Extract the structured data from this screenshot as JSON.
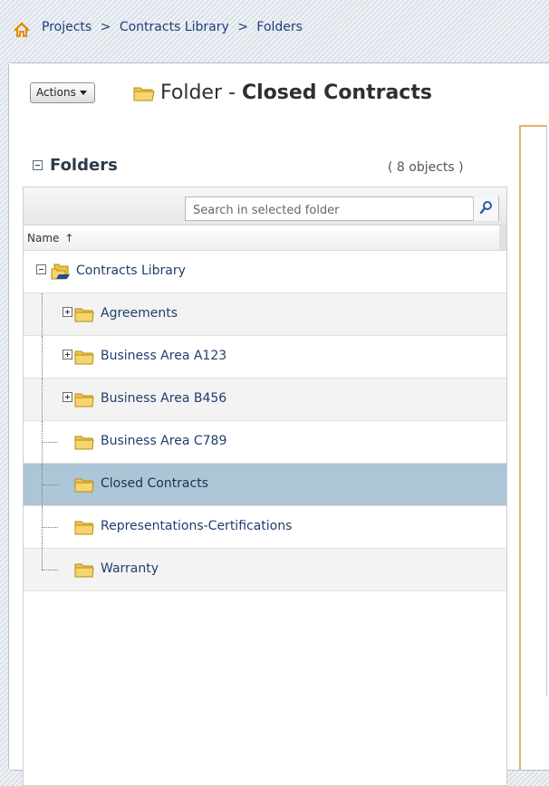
{
  "breadcrumb": {
    "home_icon": "home-icon",
    "items": [
      "Projects",
      "Contracts Library",
      "Folders"
    ],
    "separator": ">"
  },
  "header": {
    "actions_label": "Actions",
    "title_prefix": "Folder",
    "title_separator": "-",
    "title_name": "Closed Contracts"
  },
  "folders_panel": {
    "title": "Folders",
    "count": "( 8 objects )",
    "search_placeholder": "Search in selected folder",
    "column_name": "Name",
    "sort_indicator": "↑",
    "items": [
      {
        "label": "Contracts Library"
      },
      {
        "label": "Agreements"
      },
      {
        "label": "Business Area A123"
      },
      {
        "label": "Business Area B456"
      },
      {
        "label": "Business Area C789"
      },
      {
        "label": "Closed Contracts"
      },
      {
        "label": "Representations-Certifications"
      },
      {
        "label": "Warranty"
      }
    ]
  },
  "colors": {
    "accent": "#e2b266",
    "selected_row": "#adc6d7",
    "link": "#1f3f7a"
  }
}
